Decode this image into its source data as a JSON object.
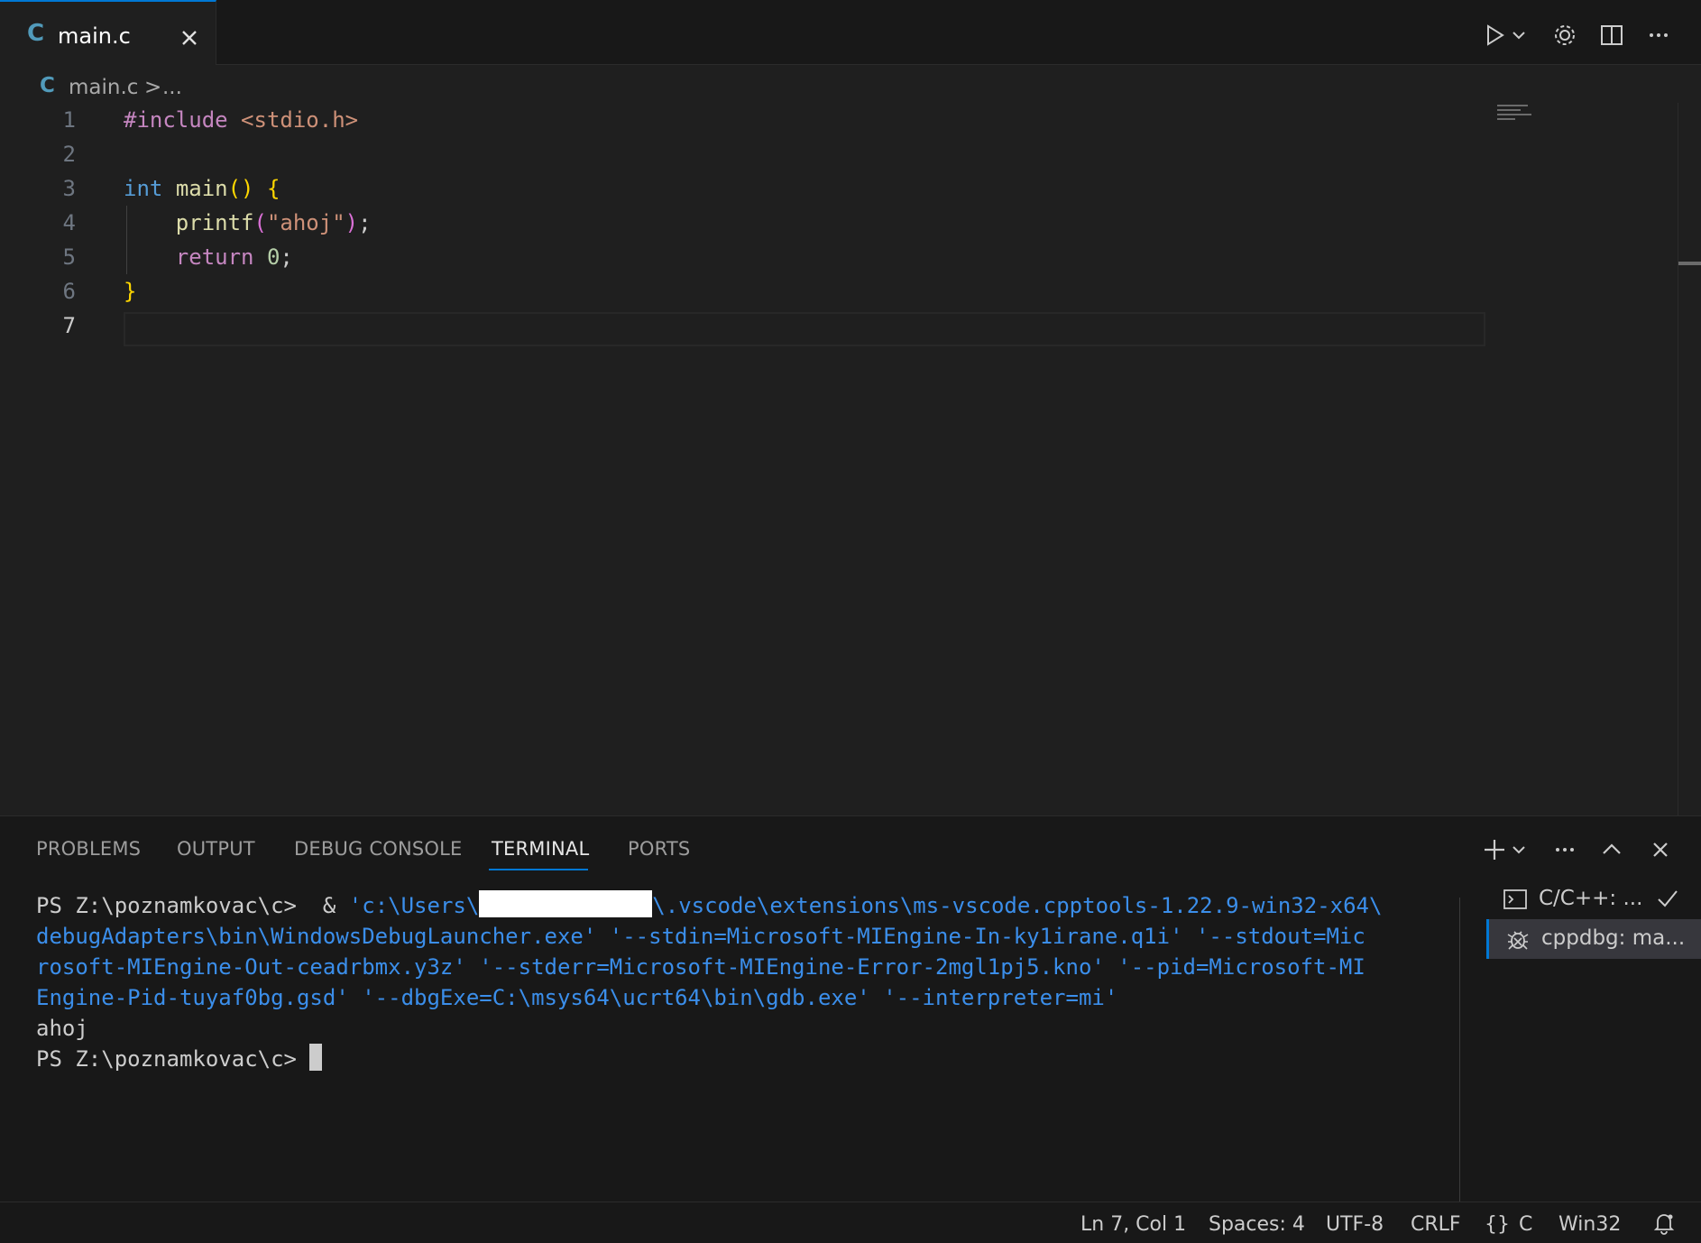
{
  "tab": {
    "icon_label": "C",
    "filename": "main.c",
    "close_icon": "close-icon"
  },
  "editor_actions": [
    "run-icon",
    "chevron-down-icon",
    "gear-icon",
    "split-editor-icon",
    "more-actions-icon"
  ],
  "breadcrumb": {
    "icon_label": "C",
    "file": "main.c",
    "separator": ">",
    "more": "..."
  },
  "editor": {
    "line_numbers": [
      "1",
      "2",
      "3",
      "4",
      "5",
      "6",
      "7"
    ],
    "active_line": "7",
    "tokens": {
      "l1_directive": "#include",
      "l1_header": "<stdio.h>",
      "l3_type": "int",
      "l3_fn": "main",
      "l3_parens": "()",
      "l3_brace": "{",
      "l4_fn": "printf",
      "l4_open": "(",
      "l4_str": "\"ahoj\"",
      "l4_close": ")",
      "l4_semi": ";",
      "l5_kw": "return",
      "l5_num": "0",
      "l5_semi": ";",
      "l6_brace": "}"
    }
  },
  "panel": {
    "tabs": [
      "PROBLEMS",
      "OUTPUT",
      "DEBUG CONSOLE",
      "TERMINAL",
      "PORTS"
    ],
    "active_tab": "TERMINAL",
    "actions": [
      "add-icon",
      "chevron-down-icon",
      "more-actions-icon",
      "maximize-chevron-up-icon",
      "close-icon"
    ]
  },
  "terminal": {
    "prompt": "PS Z:\\poznamkovac\\c>",
    "cmd_amp": "&",
    "cmd_line1_a": "'c:\\Users\\",
    "cmd_line1_b": "\\.vscode\\extensions\\ms-vscode.cpptools-1.22.9-win32-x64\\",
    "cmd_line2": "debugAdapters\\bin\\WindowsDebugLauncher.exe' '--stdin=Microsoft-MIEngine-In-ky1irane.q1i' '--stdout=Mic",
    "cmd_line3": "rosoft-MIEngine-Out-ceadrbmx.y3z' '--stderr=Microsoft-MIEngine-Error-2mgl1pj5.kno' '--pid=Microsoft-MI",
    "cmd_line4": "Engine-Pid-tuyaf0bg.gsd' '--dbgExe=C:\\msys64\\ucrt64\\bin\\gdb.exe' '--interpreter=mi'",
    "output": "ahoj",
    "prompt2": "PS Z:\\poznamkovac\\c>"
  },
  "terminal_list": [
    {
      "label": "C/C++: ...",
      "icon": "terminal-icon",
      "status_icon": "check-icon",
      "selected": false
    },
    {
      "label": "cppdbg: ma...",
      "icon": "debug-icon",
      "selected": true
    }
  ],
  "statusbar": {
    "position": "Ln 7, Col 1",
    "spaces": "Spaces: 4",
    "encoding": "UTF-8",
    "eol": "CRLF",
    "lang_brace": "{}",
    "language": "C",
    "platform": "Win32",
    "bell_icon": "notification-bell-icon"
  },
  "colors": {
    "accent": "#0078d4",
    "editor_bg": "#1f1f1f",
    "panel_bg": "#181818",
    "keyword": "#569cd6",
    "control": "#c586c0",
    "string": "#ce9178",
    "function": "#dcdcaa",
    "terminal_link": "#3b8eea"
  }
}
